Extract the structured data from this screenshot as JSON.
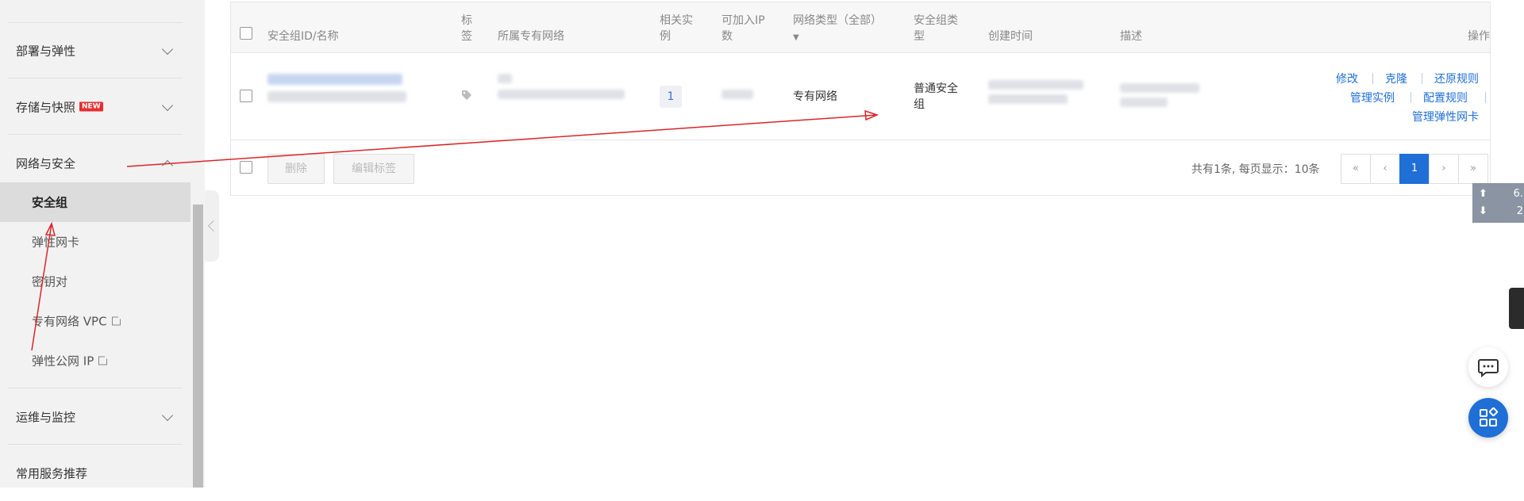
{
  "sidebar": {
    "groups": [
      {
        "label": "部署与弹性"
      },
      {
        "label": "存储与快照",
        "badge": "NEW"
      },
      {
        "label": "网络与安全"
      },
      {
        "label": "运维与监控"
      },
      {
        "label": "常用服务推荐"
      }
    ],
    "network_items": [
      {
        "label": "安全组"
      },
      {
        "label": "弹性网卡"
      },
      {
        "label": "密钥对"
      },
      {
        "label": "专有网络 VPC"
      },
      {
        "label": "弹性公网 IP"
      }
    ]
  },
  "table": {
    "headers": {
      "id_name": "安全组ID/名称",
      "tag_line1": "标",
      "tag_line2": "签",
      "vpc": "所属专有网络",
      "instances_line1": "相关实",
      "instances_line2": "例",
      "ip_line1": "可加入IP",
      "ip_line2": "数",
      "net_type": "网络类型（全部）",
      "sg_type_line1": "安全组类",
      "sg_type_line2": "型",
      "created": "创建时间",
      "desc": "描述",
      "ops": "操作"
    },
    "row": {
      "instances": "1",
      "net_type": "专有网络",
      "sg_type_line1": "普通安全",
      "sg_type_line2": "组",
      "ops": [
        "修改",
        "克隆",
        "还原规则",
        "管理实例",
        "配置规则",
        "管理弹性网卡"
      ]
    },
    "footer": {
      "delete_label": "删除",
      "edit_tags_label": "编辑标签",
      "summary": "共有1条, 每页显示：10条",
      "pages": [
        "«",
        "‹",
        "1",
        "›",
        "»"
      ]
    }
  },
  "traffic": {
    "up_value": "6.",
    "down_value": "2"
  },
  "colors": {
    "accent": "#1f6fd6",
    "annotation": "#d9262a"
  }
}
